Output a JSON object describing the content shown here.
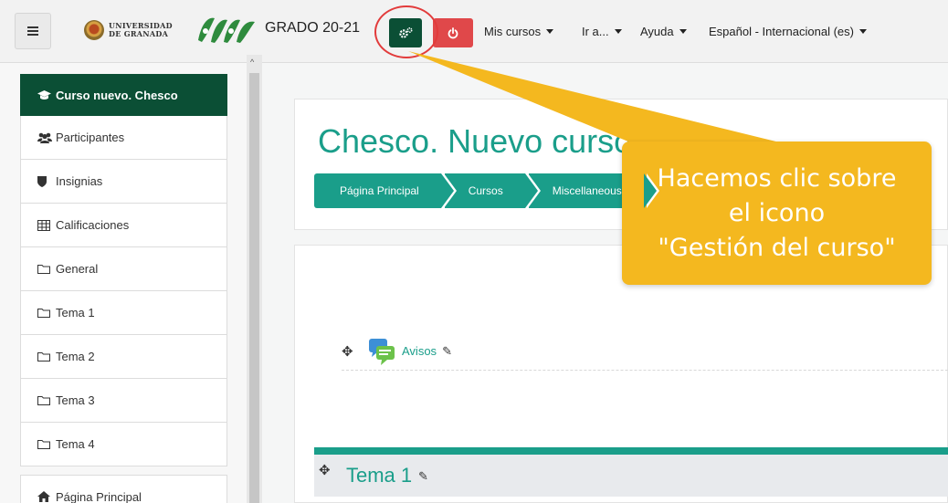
{
  "navbar": {
    "university_line1": "UNIVERSIDAD",
    "university_line2": "DE GRANADA",
    "site_name": "GRADO 20-21",
    "menus": [
      {
        "label": "Mis cursos"
      },
      {
        "label": "Ir a..."
      },
      {
        "label": "Ayuda"
      },
      {
        "label": "Español - Internacional (es)"
      }
    ],
    "gear_icon": "cogs-icon",
    "power_icon": "power-icon",
    "colors": {
      "gear_button": "#0b4f35",
      "power_button": "#e0484a"
    }
  },
  "sidebar": {
    "items": [
      {
        "label": "Curso nuevo. Chesco",
        "icon": "graduation-cap-icon"
      },
      {
        "label": "Participantes",
        "icon": "users-icon"
      },
      {
        "label": "Insignias",
        "icon": "shield-icon"
      },
      {
        "label": "Calificaciones",
        "icon": "table-icon"
      },
      {
        "label": "General",
        "icon": "folder-icon"
      },
      {
        "label": "Tema 1",
        "icon": "folder-icon"
      },
      {
        "label": "Tema 2",
        "icon": "folder-icon"
      },
      {
        "label": "Tema 3",
        "icon": "folder-icon"
      },
      {
        "label": "Tema 4",
        "icon": "folder-icon"
      }
    ],
    "home_item": {
      "label": "Página Principal",
      "icon": "home-icon"
    }
  },
  "main": {
    "title": "Chesco. Nuevo curso",
    "breadcrumb": [
      "Página Principal",
      "Cursos",
      "Miscellaneous"
    ],
    "activity": {
      "label": "Avisos",
      "icon": "forum-icon"
    },
    "section": {
      "title": "Tema 1"
    },
    "accent_color": "#1a9e8a"
  },
  "callout": {
    "line1": "Hacemos clic sobre",
    "line2": "el icono",
    "line3": "\"Gestión del curso\"",
    "color": "#f4b81f"
  }
}
